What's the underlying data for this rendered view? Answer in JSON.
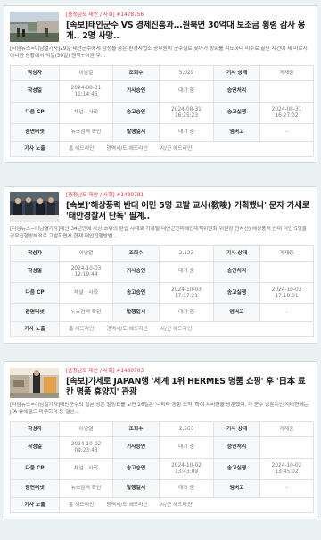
{
  "labels": {
    "writer": "작성자",
    "views": "조회수",
    "status": "기사 상태",
    "created": "작성일",
    "approver": "기사승인",
    "approval": "승인처리",
    "daum_cp": "다음 CP",
    "send_approval": "송고승인",
    "send_status": "송고실행",
    "exposure_edit": "중면터넷",
    "publish_site": "발행일시",
    "online": "엠버고",
    "article_exposure": "기사 노출"
  },
  "articles": [
    {
      "category": "[충청남도 태안 / 사회] #1478756",
      "title": "[속보]태안군수 VS 경제진흥과...원북면 30억대 보조금 횡령 감사 몽개.. 2명 사망..",
      "summary": "[타임뉴스=이남열기자]29일 태안군수에게 감정을 품은 환경사업소 공무원이 군수실로 찾아가 방화를 시도하다 미수로 끝난 사건이 제 미르지 아니한 상황에서 익일(30일) 원북+이원 주...",
      "writer": "이남열",
      "views": "5,029",
      "status": "게재중",
      "created": "2024-08-31\n11:14:45",
      "approver_val": "대기 중",
      "approval_val": "",
      "channel": "채널 : 사회",
      "send_approval_val": "2024-08-31\n16:25:23",
      "send_status_val": "2024-08-31\n16:27:02",
      "news_check": "뉴스검색 확인",
      "publish_val": "대기 중",
      "online_val": "-",
      "exposure": [
        "홈 헤드라인",
        "광역시/도 헤드라인",
        "시/군 헤드라인"
      ]
    },
    {
      "category": "[충청남도 태안 / 사회] #1480781",
      "title": "[속보]'해상풍력 반대 어민 5명 고발 교사(敎唆) 기획했나' 문자 가세로 '태안경찰서 단독' 필계..",
      "summary": "[타임뉴스=이남열기자]태안 34년만에 사상 초유의 탄압 사태로 기록될 태안군전피해민대책위원회(위원장 전치선) 해상풍력 반대 어민 5명을 공무집행방해죄로 고발하면서 현재 대안진행방범...",
      "writer": "이남열",
      "views": "2,123",
      "status": "게재중",
      "created": "2024-10-03\n12:19:44",
      "approver_val": "대기 중",
      "approval_val": "",
      "channel": "채널 : 사회",
      "send_approval_val": "2024-10-03\n17:17:21",
      "send_status_val": "2024-10-03\n17:18:01",
      "news_check": "뉴스검색 확인",
      "publish_val": "대기 중",
      "online_val": "-",
      "exposure": [
        "홈 헤드라인",
        "광역시/도 헤드라인",
        "시/군 헤드라인"
      ]
    },
    {
      "category": "[충청남도 태안 / 사회] #1480703",
      "title": "[속보]가세로 JAPAN행 '세계 1위 HERMES 명품 쇼핑' 후 '日本 료칸 명품 휴양지' 관광",
      "summary": "[타임뉴스=이남열기자]태안군수의 일본 방문 일정표를 보면 26일은 '나리타 공항 도착' 하여 치바현을 방문했다. 가 군수 방문지인 지바현에는 JFA 유해필드 마쿠하리 등 일본...",
      "writer": "이남열",
      "views": "2,563",
      "status": "게재중",
      "created": "2024-10-02\n09:23:43",
      "approver_val": "대기 중",
      "approval_val": "",
      "channel": "채널 : 사회",
      "send_approval_val": "2024-10-02\n13:43:09",
      "send_status_val": "2024-10-02\n13:45:02",
      "news_check": "뉴스검색 확인",
      "publish_val": "대기 중",
      "online_val": "-",
      "exposure": [
        "홈 헤드라인",
        "광역시/도 헤드라인",
        "시/군 헤드라인"
      ]
    }
  ]
}
